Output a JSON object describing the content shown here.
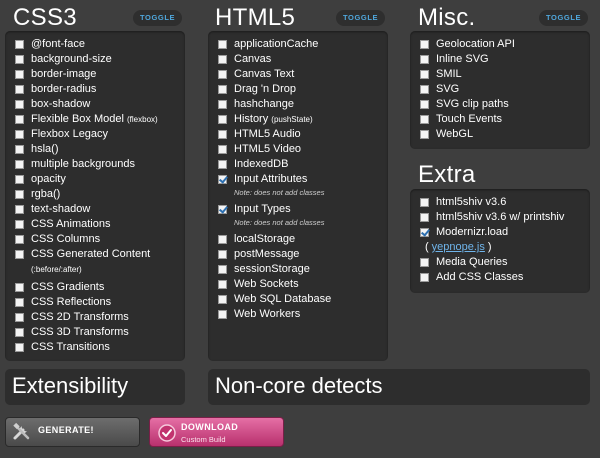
{
  "css3": {
    "title": "CSS3",
    "toggle": "TOGGLE",
    "items": [
      {
        "label": "@font-face",
        "extra": "",
        "checked": false
      },
      {
        "label": "background-size",
        "extra": "",
        "checked": false
      },
      {
        "label": "border-image",
        "extra": "",
        "checked": false
      },
      {
        "label": "border-radius",
        "extra": "",
        "checked": false
      },
      {
        "label": "box-shadow",
        "extra": "",
        "checked": false
      },
      {
        "label": "Flexible Box Model",
        "extra": "(flexbox)",
        "checked": false
      },
      {
        "label": "Flexbox Legacy",
        "extra": "",
        "checked": false
      },
      {
        "label": "hsla()",
        "extra": "",
        "checked": false
      },
      {
        "label": "multiple backgrounds",
        "extra": "",
        "checked": false
      },
      {
        "label": "opacity",
        "extra": "",
        "checked": false
      },
      {
        "label": "rgba()",
        "extra": "",
        "checked": false
      },
      {
        "label": "text-shadow",
        "extra": "",
        "checked": false
      },
      {
        "label": "CSS Animations",
        "extra": "",
        "checked": false
      },
      {
        "label": "CSS Columns",
        "extra": "",
        "checked": false
      },
      {
        "label": "CSS Generated Content",
        "extra": "(:before/:after)",
        "checked": false
      },
      {
        "label": "CSS Gradients",
        "extra": "",
        "checked": false
      },
      {
        "label": "CSS Reflections",
        "extra": "",
        "checked": false
      },
      {
        "label": "CSS 2D Transforms",
        "extra": "",
        "checked": false
      },
      {
        "label": "CSS 3D Transforms",
        "extra": "",
        "checked": false
      },
      {
        "label": "CSS Transitions",
        "extra": "",
        "checked": false
      }
    ]
  },
  "html5": {
    "title": "HTML5",
    "toggle": "TOGGLE",
    "items": [
      {
        "label": "applicationCache",
        "extra": "",
        "note": "",
        "checked": false
      },
      {
        "label": "Canvas",
        "extra": "",
        "note": "",
        "checked": false
      },
      {
        "label": "Canvas Text",
        "extra": "",
        "note": "",
        "checked": false
      },
      {
        "label": "Drag 'n Drop",
        "extra": "",
        "note": "",
        "checked": false
      },
      {
        "label": "hashchange",
        "extra": "",
        "note": "",
        "checked": false
      },
      {
        "label": "History",
        "extra": "(pushState)",
        "note": "",
        "checked": false
      },
      {
        "label": "HTML5 Audio",
        "extra": "",
        "note": "",
        "checked": false
      },
      {
        "label": "HTML5 Video",
        "extra": "",
        "note": "",
        "checked": false
      },
      {
        "label": "IndexedDB",
        "extra": "",
        "note": "",
        "checked": false
      },
      {
        "label": "Input Attributes",
        "extra": "",
        "note": "Note: does not add classes",
        "checked": true
      },
      {
        "label": "Input Types",
        "extra": "",
        "note": "Note: does not add classes",
        "checked": true
      },
      {
        "label": "localStorage",
        "extra": "",
        "note": "",
        "checked": false
      },
      {
        "label": "postMessage",
        "extra": "",
        "note": "",
        "checked": false
      },
      {
        "label": "sessionStorage",
        "extra": "",
        "note": "",
        "checked": false
      },
      {
        "label": "Web Sockets",
        "extra": "",
        "note": "",
        "checked": false
      },
      {
        "label": "Web SQL Database",
        "extra": "",
        "note": "",
        "checked": false
      },
      {
        "label": "Web Workers",
        "extra": "",
        "note": "",
        "checked": false
      }
    ]
  },
  "misc": {
    "title": "Misc.",
    "toggle": "TOGGLE",
    "items": [
      {
        "label": "Geolocation API",
        "checked": false
      },
      {
        "label": "Inline SVG",
        "checked": false
      },
      {
        "label": "SMIL",
        "checked": false
      },
      {
        "label": "SVG",
        "checked": false
      },
      {
        "label": "SVG clip paths",
        "checked": false
      },
      {
        "label": "Touch Events",
        "checked": false
      },
      {
        "label": "WebGL",
        "checked": false
      }
    ]
  },
  "extra": {
    "title": "Extra",
    "items": [
      {
        "label": "html5shiv v3.6",
        "checked": false
      },
      {
        "label": "html5shiv v3.6 w/ printshiv",
        "checked": false
      },
      {
        "label": "Modernizr.load",
        "checked": true
      },
      {
        "label": "Media Queries",
        "checked": false
      },
      {
        "label": "Add CSS Classes",
        "checked": false
      }
    ],
    "yepnope_open": "(",
    "yepnope_link": "yepnope.js",
    "yepnope_close": ")"
  },
  "extensibility": {
    "title": "Extensibility"
  },
  "noncore": {
    "title": "Non-core detects"
  },
  "buttons": {
    "generate": "GENERATE!",
    "download": "DOWNLOAD",
    "download_sub": "Custom Build"
  },
  "colors": {
    "background": "#3e3e3e",
    "panel": "#2d2d2d",
    "toggle_text": "#4fa6db",
    "download_button": "#d4478a",
    "generate_button": "#5a5a5a"
  },
  "icons": {
    "generate": "tools-icon",
    "download": "download-icon"
  }
}
